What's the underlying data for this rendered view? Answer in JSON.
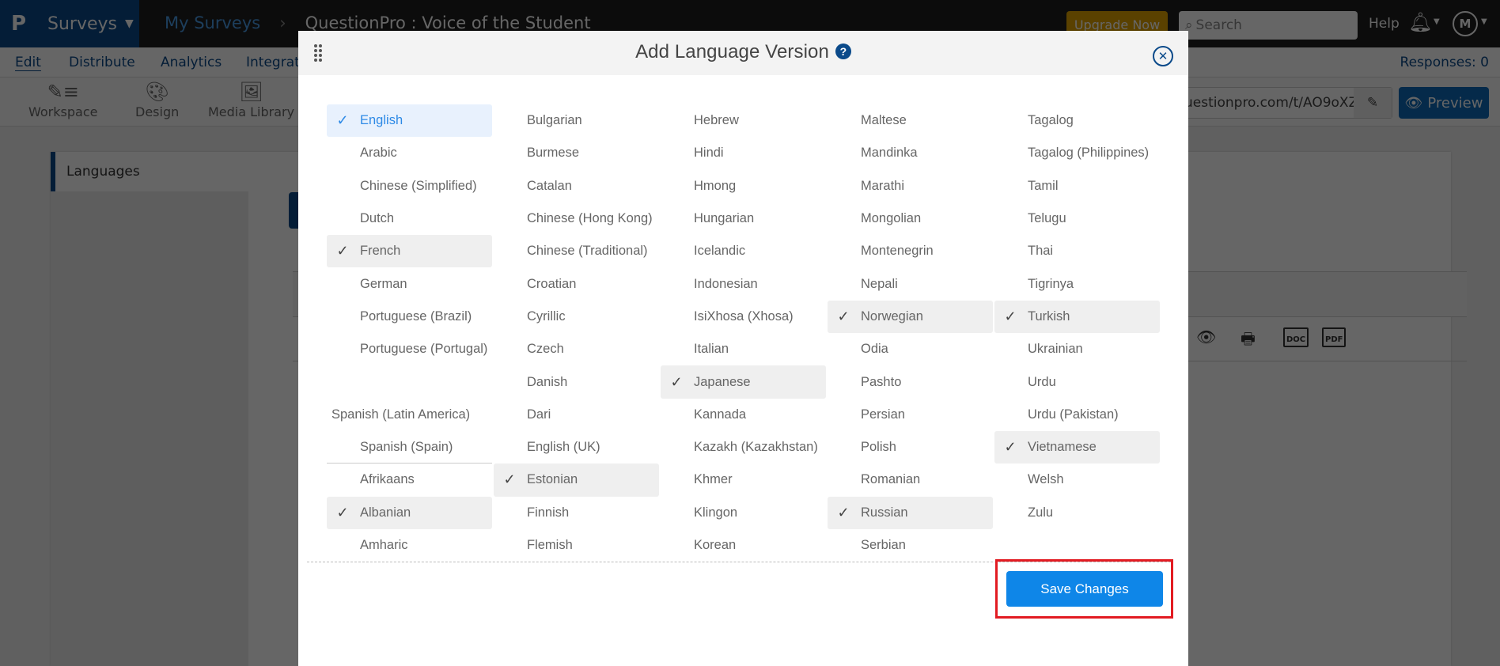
{
  "topbar": {
    "logo": "P",
    "product": "Surveys",
    "breadcrumb": [
      "My Surveys",
      "QuestionPro : Voice of the Student"
    ],
    "upgrade_label": "Upgrade Now",
    "search_placeholder": "Search",
    "help_label": "Help",
    "avatar_initial": "M"
  },
  "nav": {
    "tabs": [
      "Edit",
      "Distribute",
      "Analytics",
      "Integrations"
    ],
    "active_tab": "Edit",
    "responses": "Responses: 0"
  },
  "toolbar": {
    "tools": [
      "Workspace",
      "Design",
      "Media Library"
    ],
    "survey_url": "uestionpro.com/t/AO9oXZ",
    "preview_label": "Preview"
  },
  "sidebar": {
    "languages_label": "Languages"
  },
  "modal": {
    "title": "Add Language Version",
    "save_label": "Save Changes",
    "columns": [
      [
        {
          "label": "English",
          "checked": true,
          "primary": true
        },
        {
          "label": "Arabic",
          "checked": false
        },
        {
          "label": "Chinese (Simplified)",
          "checked": false
        },
        {
          "label": "Dutch",
          "checked": false
        },
        {
          "label": "French",
          "checked": true
        },
        {
          "label": "German",
          "checked": false
        },
        {
          "label": "Portuguese (Brazil)",
          "checked": false
        },
        {
          "label": "Portuguese (Portugal)",
          "checked": false
        },
        {
          "label": "",
          "spacer": true
        },
        {
          "label": "Spanish (Latin America)",
          "checked": false,
          "outdent": true
        },
        {
          "label": "Spanish (Spain)",
          "checked": false,
          "divider": true
        },
        {
          "label": "Afrikaans",
          "checked": false
        },
        {
          "label": "Albanian",
          "checked": true
        },
        {
          "label": "Amharic",
          "checked": false
        }
      ],
      [
        {
          "label": "Bulgarian",
          "checked": false
        },
        {
          "label": "Burmese",
          "checked": false
        },
        {
          "label": "Catalan",
          "checked": false
        },
        {
          "label": "Chinese (Hong Kong)",
          "checked": false
        },
        {
          "label": "Chinese (Traditional)",
          "checked": false
        },
        {
          "label": "Croatian",
          "checked": false
        },
        {
          "label": "Cyrillic",
          "checked": false
        },
        {
          "label": "Czech",
          "checked": false
        },
        {
          "label": "Danish",
          "checked": false
        },
        {
          "label": "Dari",
          "checked": false
        },
        {
          "label": "English (UK)",
          "checked": false
        },
        {
          "label": "Estonian",
          "checked": true
        },
        {
          "label": "Finnish",
          "checked": false
        },
        {
          "label": "Flemish",
          "checked": false
        }
      ],
      [
        {
          "label": "Hebrew",
          "checked": false
        },
        {
          "label": "Hindi",
          "checked": false
        },
        {
          "label": "Hmong",
          "checked": false
        },
        {
          "label": "Hungarian",
          "checked": false
        },
        {
          "label": "Icelandic",
          "checked": false
        },
        {
          "label": "Indonesian",
          "checked": false
        },
        {
          "label": "IsiXhosa (Xhosa)",
          "checked": false
        },
        {
          "label": "Italian",
          "checked": false
        },
        {
          "label": "Japanese",
          "checked": true
        },
        {
          "label": "Kannada",
          "checked": false
        },
        {
          "label": "Kazakh (Kazakhstan)",
          "checked": false
        },
        {
          "label": "Khmer",
          "checked": false
        },
        {
          "label": "Klingon",
          "checked": false
        },
        {
          "label": "Korean",
          "checked": false
        }
      ],
      [
        {
          "label": "Maltese",
          "checked": false
        },
        {
          "label": "Mandinka",
          "checked": false
        },
        {
          "label": "Marathi",
          "checked": false
        },
        {
          "label": "Mongolian",
          "checked": false
        },
        {
          "label": "Montenegrin",
          "checked": false
        },
        {
          "label": "Nepali",
          "checked": false
        },
        {
          "label": "Norwegian",
          "checked": true
        },
        {
          "label": "Odia",
          "checked": false
        },
        {
          "label": "Pashto",
          "checked": false
        },
        {
          "label": "Persian",
          "checked": false
        },
        {
          "label": "Polish",
          "checked": false
        },
        {
          "label": "Romanian",
          "checked": false
        },
        {
          "label": "Russian",
          "checked": true
        },
        {
          "label": "Serbian",
          "checked": false
        }
      ],
      [
        {
          "label": "Tagalog",
          "checked": false
        },
        {
          "label": "Tagalog (Philippines)",
          "checked": false
        },
        {
          "label": "Tamil",
          "checked": false
        },
        {
          "label": "Telugu",
          "checked": false
        },
        {
          "label": "Thai",
          "checked": false
        },
        {
          "label": "Tigrinya",
          "checked": false
        },
        {
          "label": "Turkish",
          "checked": true
        },
        {
          "label": "Ukrainian",
          "checked": false
        },
        {
          "label": "Urdu",
          "checked": false
        },
        {
          "label": "Urdu (Pakistan)",
          "checked": false
        },
        {
          "label": "Vietnamese",
          "checked": true
        },
        {
          "label": "Welsh",
          "checked": false
        },
        {
          "label": "Zulu",
          "checked": false
        }
      ]
    ]
  },
  "colors": {
    "brand": "#0b4a8a",
    "primary_button": "#0e86e8",
    "highlight_box": "#e21b22",
    "upgrade": "#e2a400"
  }
}
